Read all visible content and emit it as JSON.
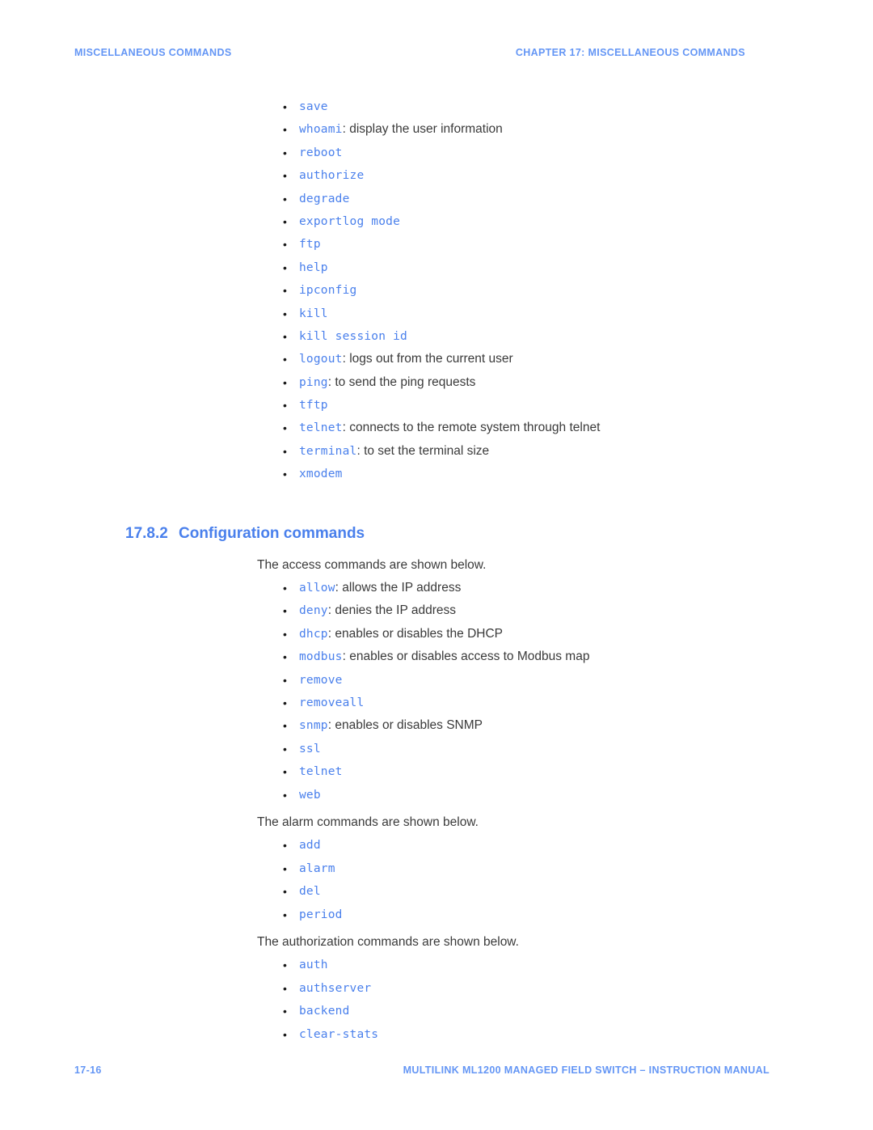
{
  "header": {
    "left": "MISCELLANEOUS COMMANDS",
    "right": "CHAPTER 17: MISCELLANEOUS COMMANDS"
  },
  "footer": {
    "page_number": "17-16",
    "manual_title": "MULTILINK ML1200 MANAGED FIELD SWITCH – INSTRUCTION MANUAL"
  },
  "colors": {
    "accent_blue": "#4a80ec",
    "header_blue": "#6496f5",
    "body_text": "#3a3a3a"
  },
  "blocks": {
    "misc_commands_list": [
      {
        "cmd": "save",
        "desc": ""
      },
      {
        "cmd": "whoami",
        "desc": ": display the user information"
      },
      {
        "cmd": "reboot",
        "desc": ""
      },
      {
        "cmd": "authorize",
        "desc": ""
      },
      {
        "cmd": "degrade",
        "desc": ""
      },
      {
        "cmd": "exportlog mode",
        "desc": ""
      },
      {
        "cmd": "ftp",
        "desc": ""
      },
      {
        "cmd": "help",
        "desc": ""
      },
      {
        "cmd": "ipconfig",
        "desc": ""
      },
      {
        "cmd": "kill",
        "desc": ""
      },
      {
        "cmd": "kill session id",
        "desc": ""
      },
      {
        "cmd": "logout",
        "desc": ": logs out from the current user"
      },
      {
        "cmd": "ping",
        "desc": ": to send the ping requests"
      },
      {
        "cmd": "tftp",
        "desc": ""
      },
      {
        "cmd": "telnet",
        "desc": ": connects to the remote system through telnet"
      },
      {
        "cmd": "terminal",
        "desc": ": to set the terminal size"
      },
      {
        "cmd": "xmodem",
        "desc": ""
      }
    ],
    "section": {
      "number": "17.8.2",
      "title": "Configuration commands"
    },
    "access_intro": "The access commands are shown below.",
    "access_list": [
      {
        "cmd": "allow",
        "desc": ": allows the IP address"
      },
      {
        "cmd": "deny",
        "desc": ": denies the IP address"
      },
      {
        "cmd": "dhcp",
        "desc": ": enables or disables the DHCP"
      },
      {
        "cmd": "modbus",
        "desc": ": enables or disables access to Modbus map"
      },
      {
        "cmd": "remove",
        "desc": ""
      },
      {
        "cmd": "removeall",
        "desc": ""
      },
      {
        "cmd": "snmp",
        "desc": ": enables or disables SNMP"
      },
      {
        "cmd": "ssl",
        "desc": ""
      },
      {
        "cmd": "telnet",
        "desc": ""
      },
      {
        "cmd": "web",
        "desc": ""
      }
    ],
    "alarm_intro": "The alarm commands are shown below.",
    "alarm_list": [
      {
        "cmd": "add",
        "desc": ""
      },
      {
        "cmd": "alarm",
        "desc": ""
      },
      {
        "cmd": "del",
        "desc": ""
      },
      {
        "cmd": "period",
        "desc": ""
      }
    ],
    "authorization_intro": "The authorization commands are shown below.",
    "authorization_list": [
      {
        "cmd": "auth",
        "desc": ""
      },
      {
        "cmd": "authserver",
        "desc": ""
      },
      {
        "cmd": "backend",
        "desc": ""
      },
      {
        "cmd": "clear-stats",
        "desc": ""
      }
    ]
  }
}
